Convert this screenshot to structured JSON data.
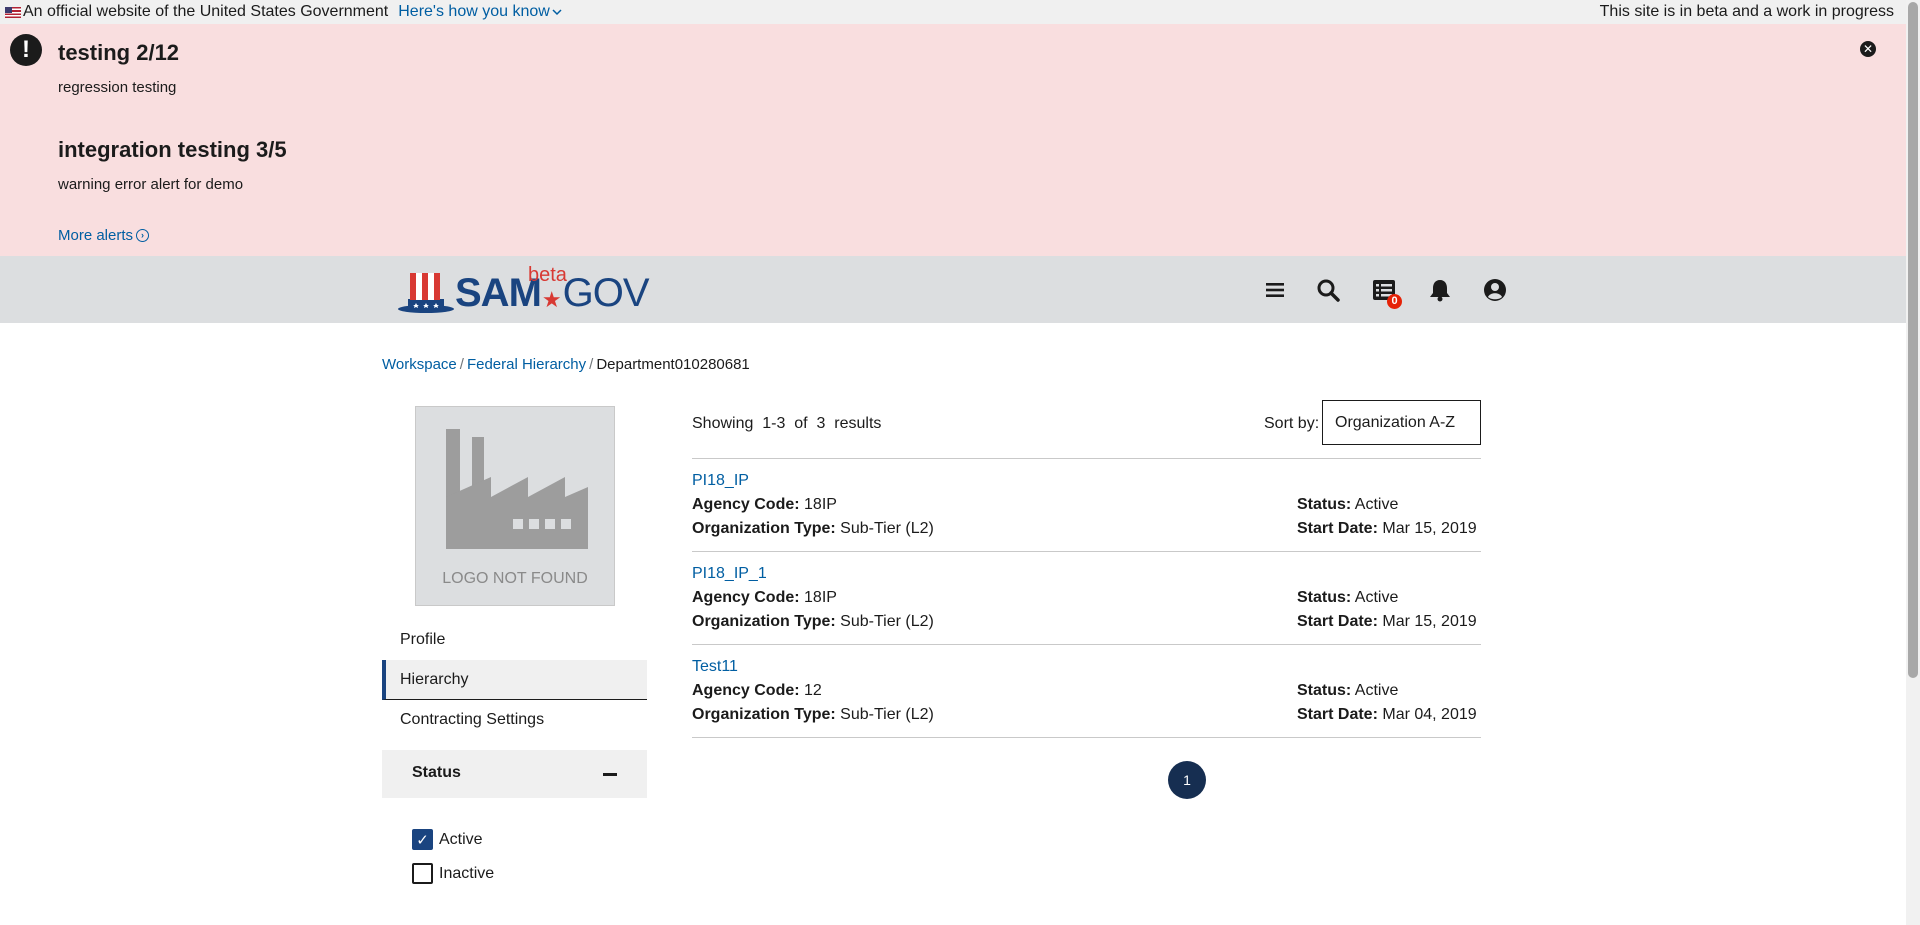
{
  "gov_banner": {
    "text": "An official website of the United States Government",
    "link": "Here's how you know",
    "beta_notice": "This site is in beta and a work in progress"
  },
  "alerts": [
    {
      "title": "testing 2/12",
      "body": "regression testing"
    },
    {
      "title": "integration testing 3/5",
      "body": "warning error alert for demo"
    }
  ],
  "more_alerts": "More alerts",
  "logo": {
    "sam": "SAM",
    "gov": "GOV",
    "beta": "beta"
  },
  "header": {
    "notification_count": "0"
  },
  "breadcrumb": {
    "items": [
      "Workspace",
      "Federal Hierarchy"
    ],
    "current": "Department010280681"
  },
  "org_logo": {
    "placeholder": "LOGO NOT FOUND"
  },
  "side_nav": {
    "items": [
      "Profile",
      "Hierarchy",
      "Contracting Settings"
    ],
    "active": "Hierarchy"
  },
  "filter": {
    "title": "Status",
    "options": [
      {
        "label": "Active",
        "checked": true
      },
      {
        "label": "Inactive",
        "checked": false
      }
    ]
  },
  "results": {
    "summary": "Showing  1-3  of  3  results",
    "sort_label": "Sort by:",
    "sort_value": "Organization A-Z",
    "agency_code_label": "Agency Code:",
    "org_type_label": "Organization Type:",
    "status_label": "Status:",
    "start_date_label": "Start Date:",
    "items": [
      {
        "name": "PI18_IP",
        "agency_code": "18IP",
        "org_type": "Sub-Tier (L2)",
        "status": "Active",
        "start_date": "Mar 15, 2019"
      },
      {
        "name": "PI18_IP_1",
        "agency_code": "18IP",
        "org_type": "Sub-Tier (L2)",
        "status": "Active",
        "start_date": "Mar 15, 2019"
      },
      {
        "name": "Test11",
        "agency_code": "12",
        "org_type": "Sub-Tier (L2)",
        "status": "Active",
        "start_date": "Mar 04, 2019"
      }
    ]
  },
  "pagination": {
    "current_page": "1"
  },
  "colors": {
    "primary": "#1a4480",
    "link": "#005ea2",
    "alert_bg": "#f9dedf",
    "header_bg": "#dcdee0",
    "badge": "#e52207",
    "page_button": "#162e51"
  }
}
